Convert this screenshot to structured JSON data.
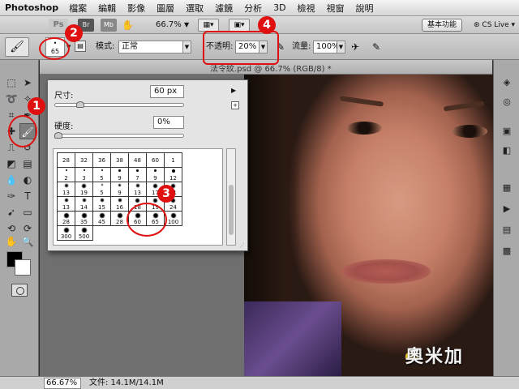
{
  "menubar": {
    "app": "Photoshop",
    "items": [
      "檔案",
      "編輯",
      "影像",
      "圖層",
      "選取",
      "濾鏡",
      "分析",
      "3D",
      "檢視",
      "視窗",
      "說明"
    ]
  },
  "appbar": {
    "ps_logo": "Ps",
    "bridge": "Br",
    "mini": "Mb",
    "zoom": "66.7%",
    "workspace": "基本功能",
    "cs_live": "CS Live"
  },
  "options": {
    "brush_size": "65",
    "mode_label": "模式:",
    "mode_value": "正常",
    "opacity_label": "不透明:",
    "opacity_value": "20%",
    "flow_label": "流量:",
    "flow_value": "100%"
  },
  "document": {
    "title": "法令紋.psd @ 66.7% (RGB/8) *"
  },
  "brush_panel": {
    "size_label": "尺寸:",
    "size_value": "60 px",
    "size_slider": 0.2,
    "hardness_label": "硬度:",
    "hardness_value": "0%",
    "hardness_slider": 0.0,
    "presets": [
      {
        "size": "28"
      },
      {
        "size": "32"
      },
      {
        "size": "36"
      },
      {
        "size": "38"
      },
      {
        "size": "48"
      },
      {
        "size": "60"
      },
      {
        "size": "1"
      },
      {
        "size": "2"
      },
      {
        "size": "3"
      },
      {
        "size": "5"
      },
      {
        "size": "9"
      },
      {
        "size": "7"
      },
      {
        "size": "9"
      },
      {
        "size": "12"
      },
      {
        "size": "13"
      },
      {
        "size": "19"
      },
      {
        "size": "5"
      },
      {
        "size": "9"
      },
      {
        "size": "13"
      },
      {
        "size": "17"
      },
      {
        "size": "21"
      },
      {
        "size": "13"
      },
      {
        "size": "14"
      },
      {
        "size": "15"
      },
      {
        "size": "16"
      },
      {
        "size": "18"
      },
      {
        "size": "19"
      },
      {
        "size": "24"
      },
      {
        "size": "28"
      },
      {
        "size": "35"
      },
      {
        "size": "45"
      },
      {
        "size": "28"
      },
      {
        "size": "60"
      },
      {
        "size": "65"
      },
      {
        "size": "100"
      },
      {
        "size": "300"
      },
      {
        "size": "500"
      }
    ]
  },
  "statusbar": {
    "zoom": "66.67%",
    "doc_info": "文件: 14.1M/14.1M"
  },
  "annotations": [
    "1",
    "2",
    "3",
    "4"
  ],
  "watermark": "奧米加",
  "colors": {
    "annotation": "#e01010",
    "foreground": "#000000",
    "background": "#ffffff"
  }
}
